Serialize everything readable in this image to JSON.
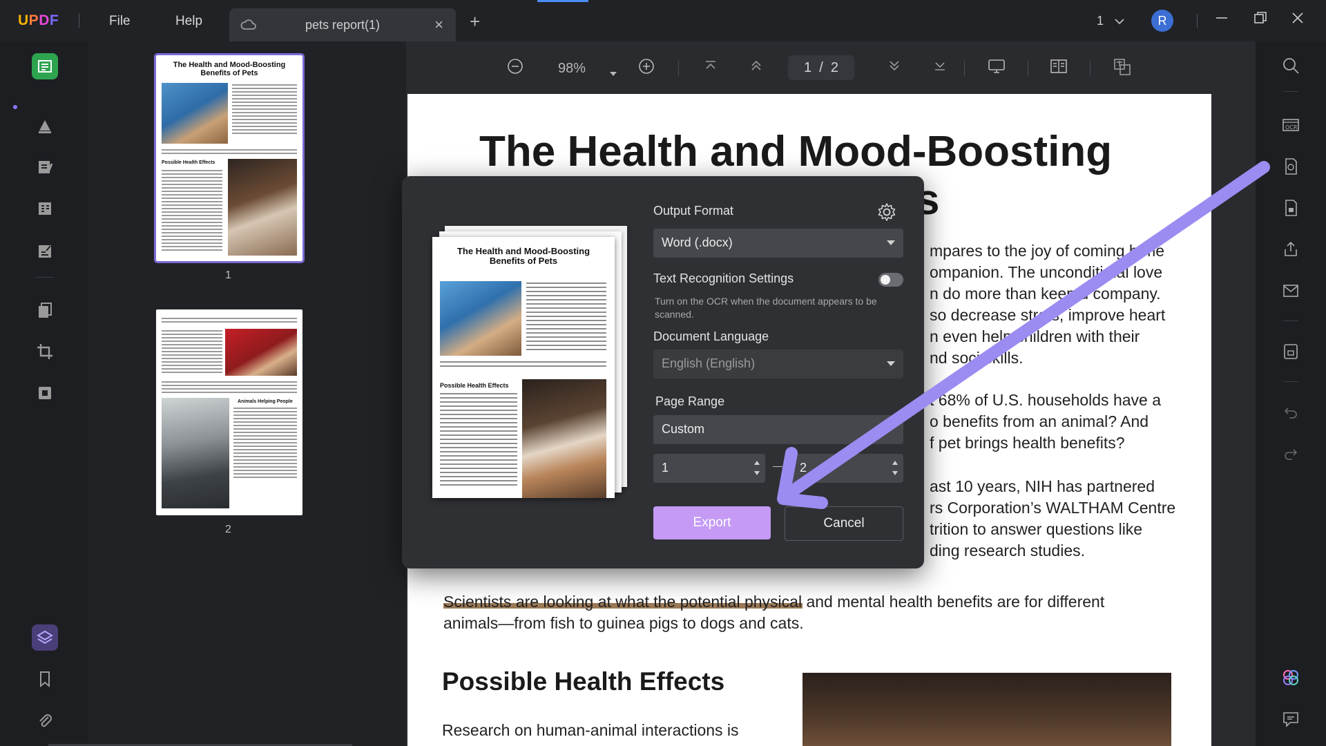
{
  "app": {
    "logo": [
      "U",
      "P",
      "D",
      "F"
    ],
    "menu": {
      "file": "File",
      "help": "Help"
    },
    "tab": {
      "title": "pets report(1)",
      "close": "×"
    },
    "add_tab": "+",
    "window_count": "1",
    "user_initial": "R"
  },
  "toolbar": {
    "zoom": "98%",
    "page_current": "1",
    "page_sep": "/",
    "page_total": "2"
  },
  "thumbnails": [
    {
      "number": "1",
      "title": "The Health and Mood-Boosting Benefits of Pets",
      "subheading": "Possible Health Effects"
    },
    {
      "number": "2",
      "subheading": "Animals Helping People"
    }
  ],
  "document": {
    "title_line1": "The Health and Mood-Boosting",
    "title_line2_visible": "s",
    "paragraphs": [
      {
        "lines": [
          "mpares to the joy of coming h   me",
          "ompanion. The unconditi   nal love",
          "n do more than keep   u company.",
          "so decrease stre   s, improve heart",
          "n even  help  children  with  their",
          "nd soci   skills."
        ]
      },
      {
        "lines": [
          "t 68% of U.S. households have a",
          "o benefits from an animal? And",
          "f pet brings health benefits?"
        ]
      },
      {
        "lines": [
          "ast 10 years, NIH has partnered",
          "rs Corporation’s WALTHAM Centre",
          "trition to answer questions like",
          "ding research studies."
        ]
      }
    ],
    "scientists_para": [
      "Scientists are looking at what the potential physical and mental health benefits are for different",
      "animals—from fish to guinea pigs to dogs and cats."
    ],
    "h2": "Possible Health Effects",
    "last_line": "Research  on  human-animal  interactions  is"
  },
  "dialog": {
    "preview_title": "The Health and Mood-Boosting Benefits of Pets",
    "preview_subheading": "Possible Health Effects",
    "output_format_label": "Output Format",
    "output_format_value": "Word (.docx)",
    "ocr_label": "Text Recognition Settings",
    "ocr_hint": "Turn on the OCR when the document appears to be scanned.",
    "ocr_enabled": false,
    "language_label": "Document Language",
    "language_value": "English (English)",
    "page_range_label": "Page Range",
    "page_range_value": "Custom",
    "range_from": "1",
    "range_to": "2",
    "export_label": "Export",
    "cancel_label": "Cancel"
  },
  "colors": {
    "accent": "#c49af4",
    "arrow": "#9b8cf2",
    "active_tool": "#2ea44f",
    "avatar": "#3c6fd3"
  }
}
